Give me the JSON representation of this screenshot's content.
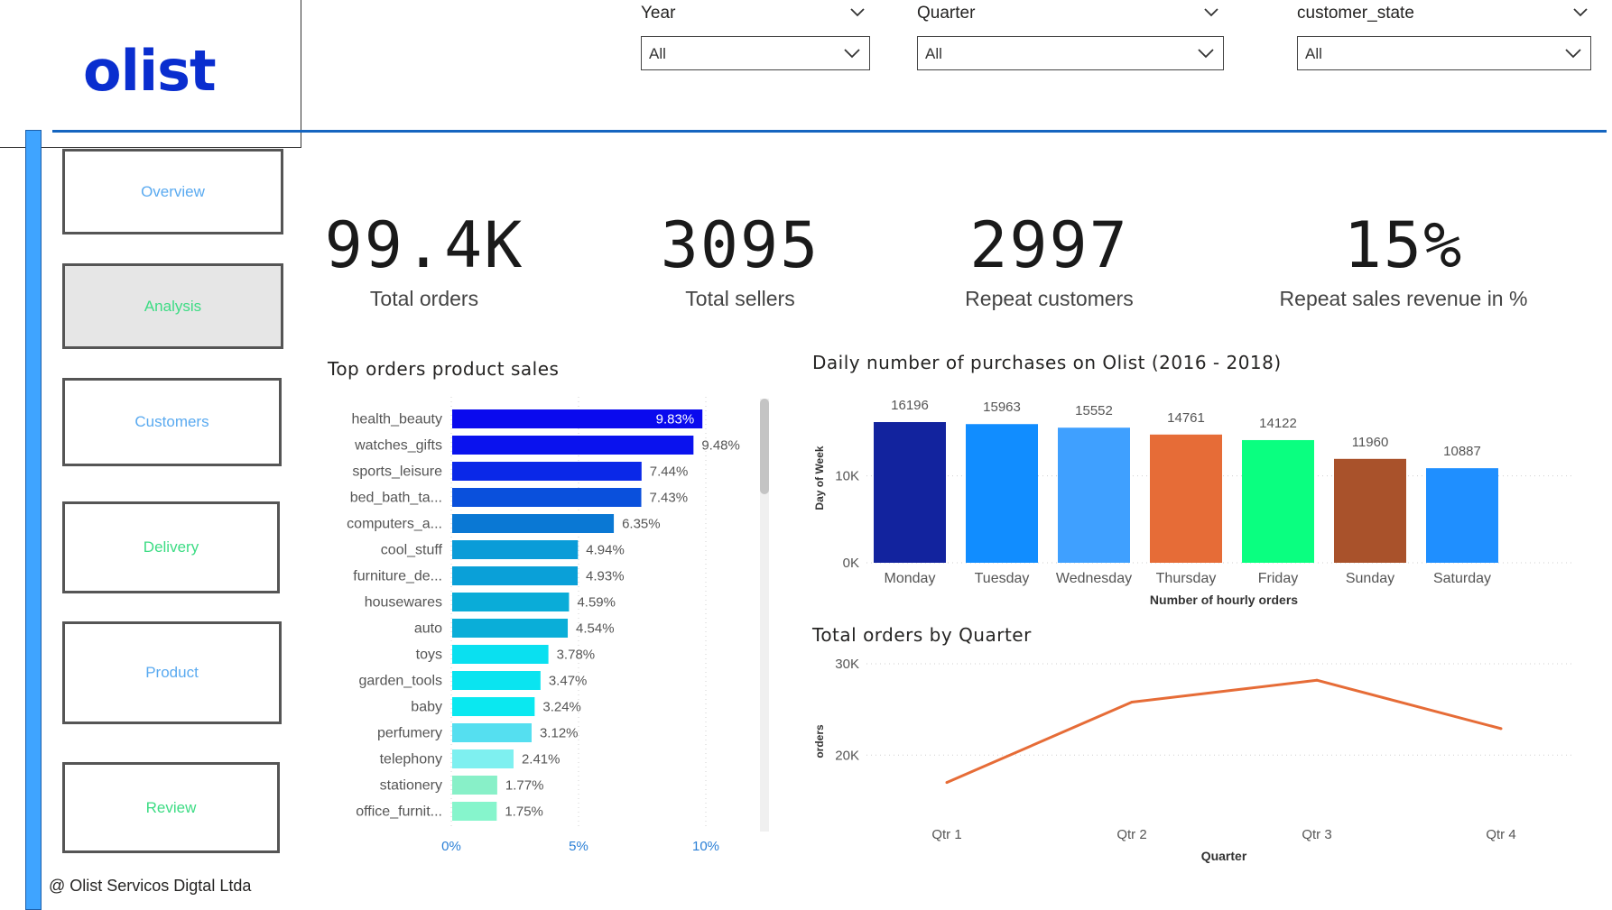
{
  "logo": "olist",
  "filters": [
    {
      "title": "Year",
      "value": "All"
    },
    {
      "title": "Quarter",
      "value": "All"
    },
    {
      "title": "customer_state",
      "value": "All"
    }
  ],
  "nav": [
    {
      "label": "Overview",
      "color": "#5aaaf0"
    },
    {
      "label": "Analysis",
      "color": "#3ddc84"
    },
    {
      "label": "Customers",
      "color": "#5aaaf0"
    },
    {
      "label": "Delivery",
      "color": "#3ddc84"
    },
    {
      "label": "Product",
      "color": "#5aaaf0"
    },
    {
      "label": "Review",
      "color": "#3ddc84"
    }
  ],
  "footer": "@ Olist Servicos Digtal Ltda",
  "kpis": [
    {
      "value": "99.4K",
      "label": "Total orders"
    },
    {
      "value": "3095",
      "label": "Total sellers"
    },
    {
      "value": "2997",
      "label": "Repeat customers"
    },
    {
      "value": "15%",
      "label": "Repeat sales revenue in %"
    }
  ],
  "chart_data": [
    {
      "type": "bar",
      "orientation": "horizontal",
      "title": "Top orders product sales",
      "categories": [
        "health_beauty",
        "watches_gifts",
        "sports_leisure",
        "bed_bath_ta...",
        "computers_a...",
        "cool_stuff",
        "furniture_de...",
        "housewares",
        "auto",
        "toys",
        "garden_tools",
        "baby",
        "perfumery",
        "telephony",
        "stationery",
        "office_furnit..."
      ],
      "values": [
        9.83,
        9.48,
        7.44,
        7.43,
        6.35,
        4.94,
        4.93,
        4.59,
        4.54,
        3.78,
        3.47,
        3.24,
        3.12,
        2.41,
        1.77,
        1.75
      ],
      "value_labels": [
        "9.83%",
        "9.48%",
        "7.44%",
        "7.43%",
        "6.35%",
        "4.94%",
        "4.93%",
        "4.59%",
        "4.54%",
        "3.78%",
        "3.47%",
        "3.24%",
        "3.12%",
        "2.41%",
        "1.77%",
        "1.75%"
      ],
      "colors": [
        "#0a0aee",
        "#0a12ee",
        "#0a28e8",
        "#0a50dc",
        "#0a78d4",
        "#0a9cd8",
        "#0aa0d8",
        "#0aacd8",
        "#0aaed8",
        "#0ae0f0",
        "#0ae4f0",
        "#0ae8f0",
        "#55dff0",
        "#7ef0f0",
        "#88f0c8",
        "#86f5cc"
      ],
      "xticks": [
        "0%",
        "5%",
        "10%"
      ],
      "xlim": [
        0,
        10
      ],
      "grid": true
    },
    {
      "type": "bar",
      "title": "Daily number of purchases on Olist (2016 - 2018)",
      "categories": [
        "Monday",
        "Tuesday",
        "Wednesday",
        "Thursday",
        "Friday",
        "Sunday",
        "Saturday"
      ],
      "values": [
        16196,
        15963,
        15552,
        14761,
        14122,
        11960,
        10887
      ],
      "colors": [
        "#12239e",
        "#118dff",
        "#3fa0ff",
        "#e66c37",
        "#0aff80",
        "#a9522b",
        "#1f8fff"
      ],
      "xlabel": "Number of hourly orders",
      "ylabel": "Day of Week",
      "yticks": [
        "0K",
        "10K"
      ],
      "ylim": [
        0,
        16196
      ],
      "grid": true
    },
    {
      "type": "line",
      "title": "Total orders by Quarter",
      "x": [
        "Qtr 1",
        "Qtr 2",
        "Qtr 3",
        "Qtr 4"
      ],
      "values": [
        17000,
        25800,
        28200,
        22900
      ],
      "color": "#e66c37",
      "xlabel": "Quarter",
      "ylabel": "orders",
      "yticks": [
        "20K",
        "30K"
      ],
      "ylim": [
        14000,
        30000
      ],
      "grid": true
    }
  ]
}
